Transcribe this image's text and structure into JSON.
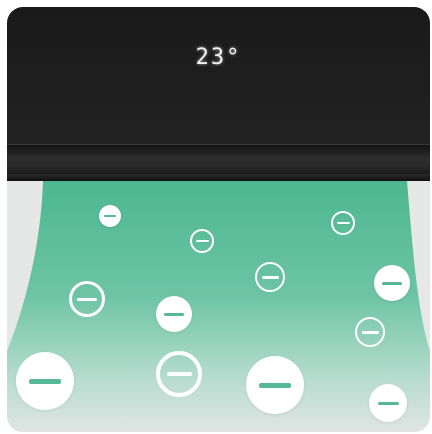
{
  "display": {
    "temperature": "23°"
  },
  "colors": {
    "unit_body": "#1f1f1f",
    "airflow_top": "#4db791",
    "airflow_bottom": "#e0e5e3",
    "background": "#e6e8e7",
    "ion_minus": "#55b998"
  },
  "ions": [
    {
      "icon": "minus-ion-icon",
      "style": "filled"
    },
    {
      "icon": "minus-ion-icon",
      "style": "outline"
    },
    {
      "icon": "minus-ion-icon",
      "style": "outline"
    },
    {
      "icon": "minus-ion-icon",
      "style": "outline"
    },
    {
      "icon": "minus-ion-icon",
      "style": "filled"
    },
    {
      "icon": "minus-ion-icon",
      "style": "outline"
    },
    {
      "icon": "minus-ion-icon",
      "style": "filled"
    },
    {
      "icon": "minus-ion-icon",
      "style": "outline"
    },
    {
      "icon": "minus-ion-icon",
      "style": "filled"
    },
    {
      "icon": "minus-ion-icon",
      "style": "outline"
    },
    {
      "icon": "minus-ion-icon",
      "style": "filled"
    },
    {
      "icon": "minus-ion-icon",
      "style": "filled"
    }
  ]
}
